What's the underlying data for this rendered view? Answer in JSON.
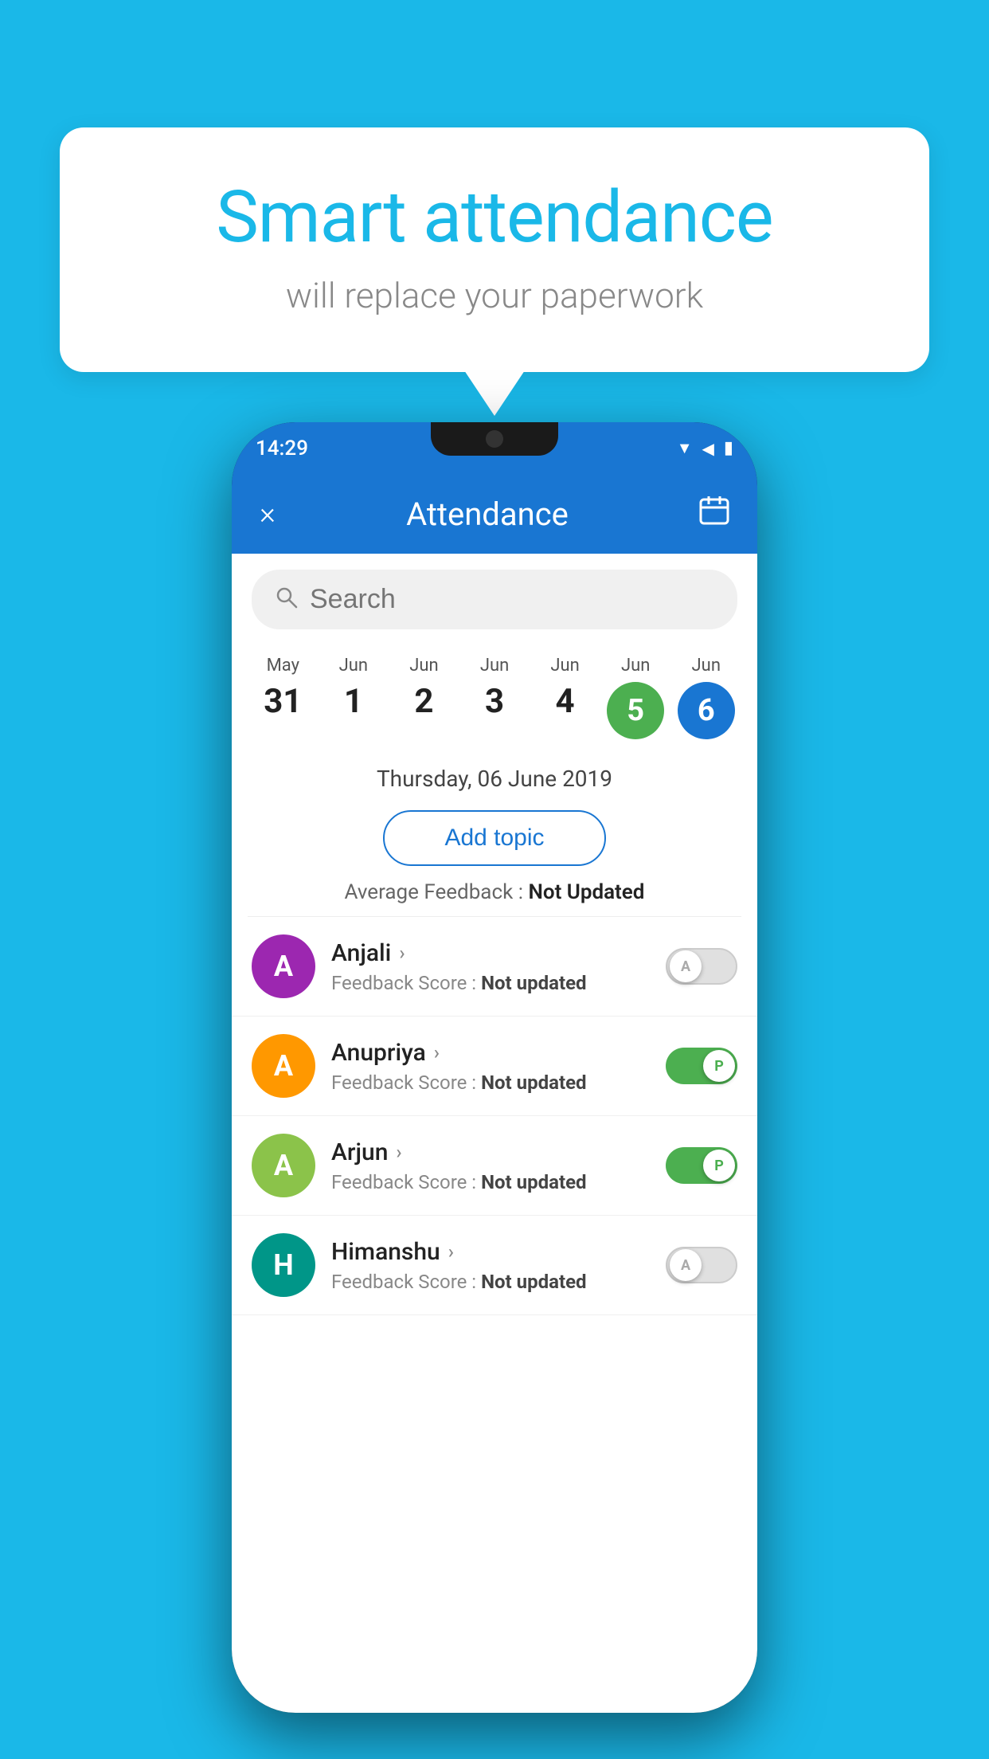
{
  "background_color": "#1ab8e8",
  "speech_bubble": {
    "title": "Smart attendance",
    "subtitle": "will replace your paperwork"
  },
  "phone": {
    "status_bar": {
      "time": "14:29",
      "icons": [
        "wifi",
        "signal",
        "battery"
      ]
    },
    "header": {
      "close_label": "×",
      "title": "Attendance",
      "calendar_icon": "calendar"
    },
    "search": {
      "placeholder": "Search"
    },
    "dates": [
      {
        "month": "May",
        "day": "31",
        "style": "normal"
      },
      {
        "month": "Jun",
        "day": "1",
        "style": "normal"
      },
      {
        "month": "Jun",
        "day": "2",
        "style": "normal"
      },
      {
        "month": "Jun",
        "day": "3",
        "style": "normal"
      },
      {
        "month": "Jun",
        "day": "4",
        "style": "normal"
      },
      {
        "month": "Jun",
        "day": "5",
        "style": "green"
      },
      {
        "month": "Jun",
        "day": "6",
        "style": "blue"
      }
    ],
    "selected_date_label": "Thursday, 06 June 2019",
    "add_topic_label": "Add topic",
    "avg_feedback_label": "Average Feedback :",
    "avg_feedback_value": "Not Updated",
    "students": [
      {
        "name": "Anjali",
        "avatar_letter": "A",
        "avatar_color": "purple",
        "feedback_label": "Feedback Score :",
        "feedback_value": "Not updated",
        "toggle_state": "off",
        "toggle_label": "A"
      },
      {
        "name": "Anupriya",
        "avatar_letter": "A",
        "avatar_color": "orange",
        "feedback_label": "Feedback Score :",
        "feedback_value": "Not updated",
        "toggle_state": "on",
        "toggle_label": "P"
      },
      {
        "name": "Arjun",
        "avatar_letter": "A",
        "avatar_color": "green-light",
        "feedback_label": "Feedback Score :",
        "feedback_value": "Not updated",
        "toggle_state": "on",
        "toggle_label": "P"
      },
      {
        "name": "Himanshu",
        "avatar_letter": "H",
        "avatar_color": "teal",
        "feedback_label": "Feedback Score :",
        "feedback_value": "Not updated",
        "toggle_state": "off",
        "toggle_label": "A"
      }
    ]
  }
}
